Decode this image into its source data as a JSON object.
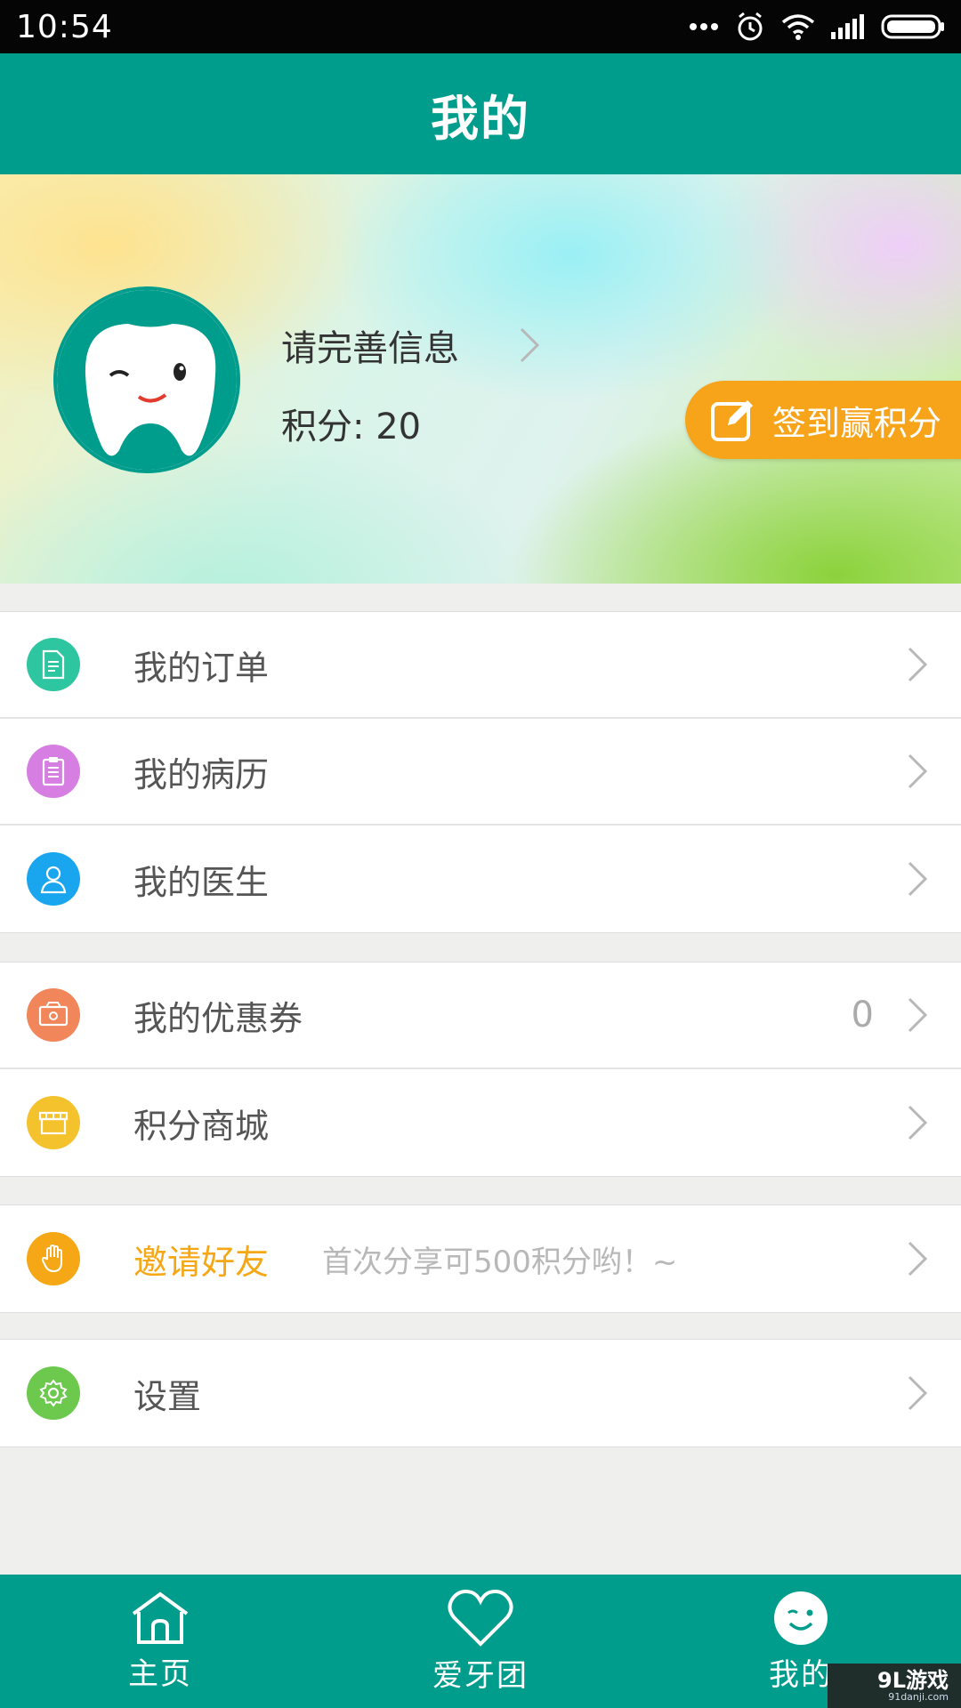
{
  "status_bar": {
    "time": "10:54"
  },
  "header": {
    "title": "我的"
  },
  "profile": {
    "name_prompt": "请完善信息",
    "points_text": "积分: 20",
    "checkin_label": "签到赢积分"
  },
  "menu": {
    "group1": [
      {
        "label": "我的订单",
        "icon": "document-icon",
        "color": "#2ec6a0"
      },
      {
        "label": "我的病历",
        "icon": "clipboard-icon",
        "color": "#d77ee3"
      },
      {
        "label": "我的医生",
        "icon": "doctor-icon",
        "color": "#1aa6ee"
      }
    ],
    "group2": [
      {
        "label": "我的优惠券",
        "icon": "coupon-icon",
        "color": "#f0865a",
        "value": "0"
      },
      {
        "label": "积分商城",
        "icon": "store-icon",
        "color": "#f4c22c"
      }
    ],
    "group3": [
      {
        "label": "邀请好友",
        "icon": "hand-icon",
        "color": "#f5a716",
        "hint": "首次分享可500积分哟！~"
      }
    ],
    "group4": [
      {
        "label": "设置",
        "icon": "gear-icon",
        "color": "#6cc94e"
      }
    ]
  },
  "bottom_nav": {
    "items": [
      {
        "label": "主页",
        "icon": "home-icon"
      },
      {
        "label": "爱牙团",
        "icon": "heart-icon"
      },
      {
        "label": "我的",
        "icon": "smiley-icon"
      }
    ]
  },
  "watermark": {
    "main": "9L游戏",
    "sub": "91danji.com"
  }
}
